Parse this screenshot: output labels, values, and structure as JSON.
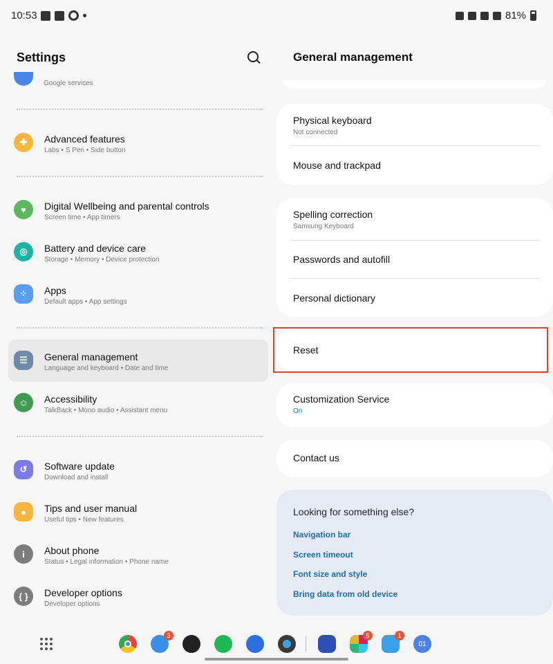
{
  "status_bar": {
    "time": "10:53",
    "battery": "81%"
  },
  "left": {
    "title": "Settings",
    "partial_item_sub": "Google services",
    "items": [
      {
        "label": "Advanced features",
        "sub": "Labs  •  S Pen  •  Side button",
        "icon": "gear-plus-icon",
        "color": "#f7b53b"
      },
      {
        "label": "Digital Wellbeing and parental controls",
        "sub": "Screen time  •  App timers",
        "icon": "heart-circle-icon",
        "color": "#5cb85c"
      },
      {
        "label": "Battery and device care",
        "sub": "Storage  •  Memory  •  Device protection",
        "icon": "battery-care-icon",
        "color": "#1bb3a4"
      },
      {
        "label": "Apps",
        "sub": "Default apps  •  App settings",
        "icon": "apps-grid-icon",
        "color": "#5b9cf0"
      },
      {
        "label": "General management",
        "sub": "Language and keyboard  •  Date and time",
        "icon": "sliders-icon",
        "color": "#6d8aa6"
      },
      {
        "label": "Accessibility",
        "sub": "TalkBack  •  Mono audio  •  Assistant menu",
        "icon": "accessibility-icon",
        "color": "#3e9b52"
      },
      {
        "label": "Software update",
        "sub": "Download and install",
        "icon": "update-icon",
        "color": "#7b7be6"
      },
      {
        "label": "Tips and user manual",
        "sub": "Useful tips  •  New features",
        "icon": "bulb-icon",
        "color": "#f7b53b"
      },
      {
        "label": "About phone",
        "sub": "Status  •  Legal information  •  Phone name",
        "icon": "info-icon",
        "color": "#7c7c7c"
      },
      {
        "label": "Developer options",
        "sub": "Developer options",
        "icon": "braces-icon",
        "color": "#7c7c7c"
      }
    ]
  },
  "right": {
    "title": "General management",
    "keyboard_card": [
      {
        "label": "Physical keyboard",
        "sub": "Not connected"
      },
      {
        "label": "Mouse and trackpad",
        "sub": ""
      }
    ],
    "text_card": [
      {
        "label": "Spelling correction",
        "sub": "Samsung Keyboard"
      },
      {
        "label": "Passwords and autofill",
        "sub": ""
      },
      {
        "label": "Personal dictionary",
        "sub": ""
      }
    ],
    "reset": "Reset",
    "customization": {
      "label": "Customization Service",
      "sub": "On"
    },
    "contact": "Contact us",
    "suggestions": {
      "title": "Looking for something else?",
      "links": [
        "Navigation bar",
        "Screen timeout",
        "Font size and style",
        "Bring data from old device"
      ]
    }
  },
  "taskbar": {
    "apps": [
      {
        "name": "chrome-icon",
        "color": "#e8453c"
      },
      {
        "name": "navigation-app-icon",
        "color": "#3a8ee6",
        "badge": "3"
      },
      {
        "name": "app-circle-icon",
        "color": "#222222"
      },
      {
        "name": "spotify-icon",
        "color": "#1db954"
      },
      {
        "name": "messages-icon",
        "color": "#2d6fe0"
      },
      {
        "name": "camera-app-icon",
        "color": "#3a3a3a"
      },
      {
        "name": "cloud-app-icon",
        "color": "#2e4fb8"
      },
      {
        "name": "slack-icon",
        "color": "#e01e5a",
        "badge": "5"
      },
      {
        "name": "chat-app-icon",
        "color": "#3aa0e8",
        "badge": "1"
      },
      {
        "name": "calendar-app-icon",
        "color": "#4b82e8",
        "label": "01"
      }
    ]
  }
}
